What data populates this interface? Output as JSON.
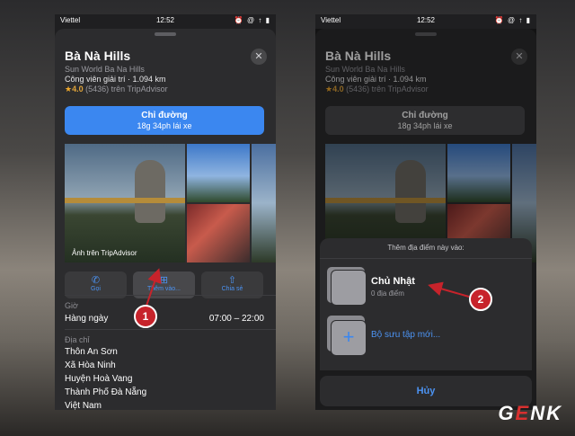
{
  "status": {
    "carrier": "Viettel",
    "time": "12:52",
    "indicators": "⏰ @ ↑ ▮"
  },
  "place": {
    "name": "Bà Nà Hills",
    "subtitle": "Sun World Ba Na Hills",
    "category": "Công viên giải trí · 1.094 km",
    "rating_value": "4.0",
    "rating_text": "(5436) trên TripAdvisor"
  },
  "directions": {
    "label": "Chỉ đường",
    "eta": "18g 34ph lái xe"
  },
  "photos": {
    "caption": "Ảnh trên TripAdvisor"
  },
  "actions": [
    {
      "icon": "phone-icon",
      "label": "Gọi"
    },
    {
      "icon": "plus-square-icon",
      "label": "Thêm vào..."
    },
    {
      "icon": "share-icon",
      "label": "Chia sẻ"
    }
  ],
  "hours": {
    "label": "Giờ",
    "day": "Hàng ngày",
    "time": "07:00 – 22:00"
  },
  "address": {
    "label": "Địa chỉ",
    "lines": [
      "Thôn An Sơn",
      "Xã Hòa Ninh",
      "Huyện Hoà Vang",
      "Thành Phố Đà Nẵng",
      "Việt Nam"
    ]
  },
  "add_sheet": {
    "header": "Thêm địa điểm này vào:",
    "collection_title": "Chủ Nhật",
    "collection_count": "0 địa điểm",
    "new_collection": "Bộ sưu tập mới...",
    "cancel": "Hủy"
  },
  "badges": [
    "1",
    "2"
  ],
  "logo": {
    "pre": "G",
    "e": "E",
    "post": "NK"
  },
  "colors": {
    "accent": "#3b87f0",
    "badge": "#c7232b",
    "star": "#f0a92c"
  }
}
